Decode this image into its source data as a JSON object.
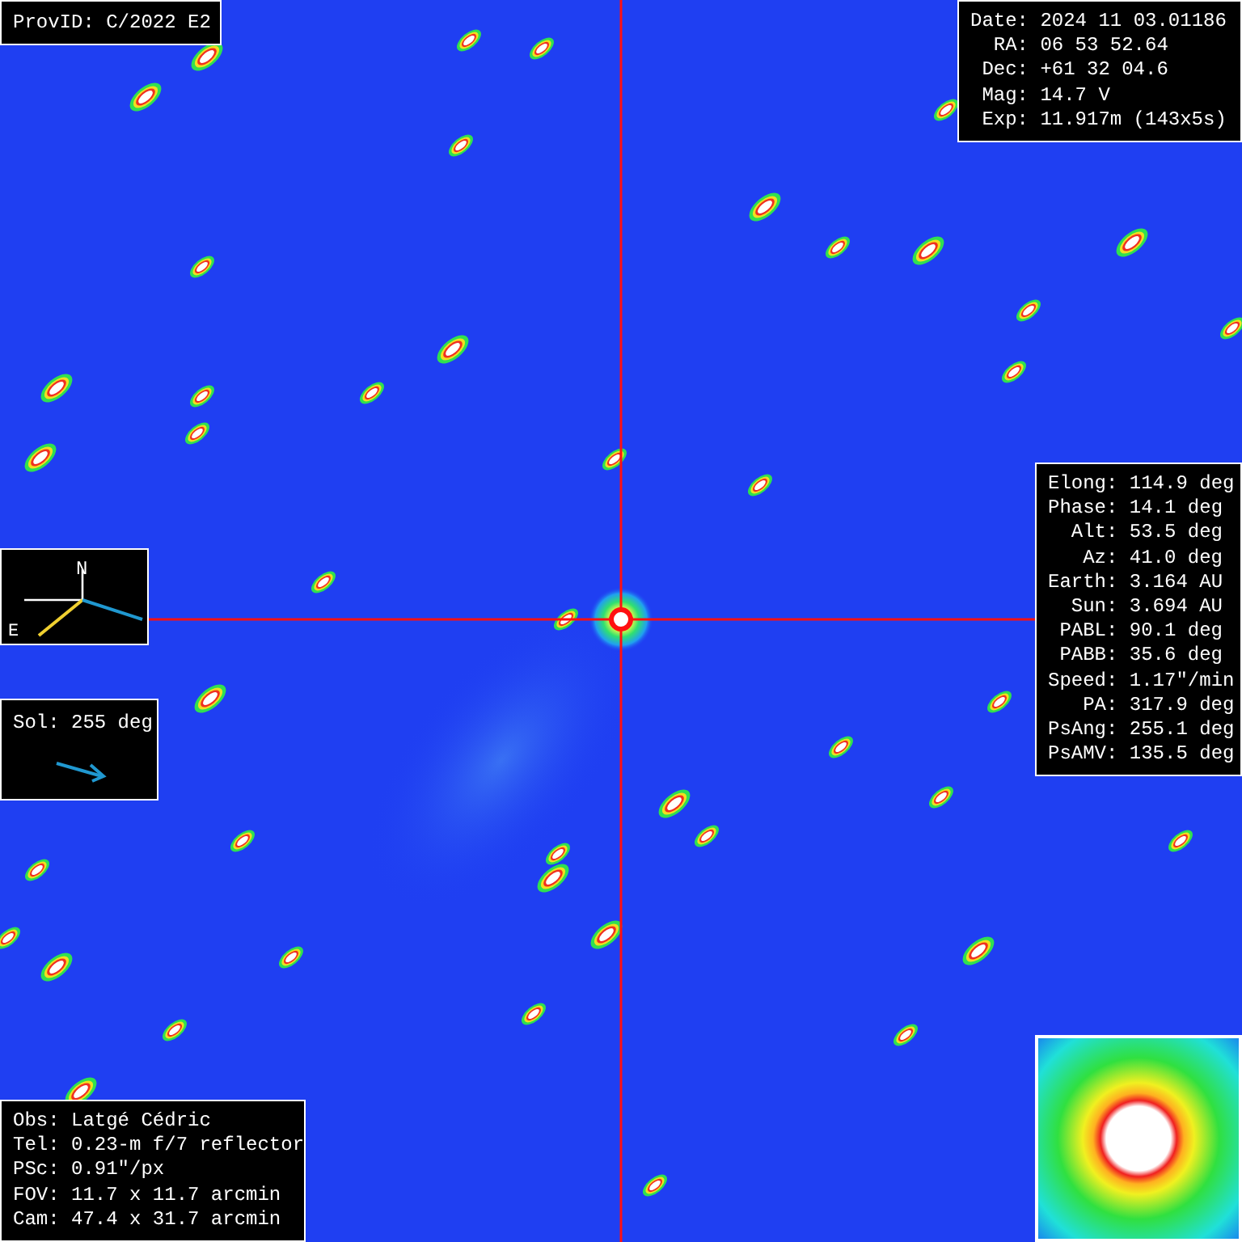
{
  "header": {
    "prov_id": "ProvID: C/2022 E2"
  },
  "observation": {
    "lines": [
      "Date: 2024 11 03.01186",
      "RA: 06 53 52.64",
      "Dec: +61 32 04.6",
      "Mag: 14.7 V",
      "Exp: 11.917m (143x5s)"
    ]
  },
  "geometry": {
    "lines": [
      "Elong: 114.9 deg",
      "Phase: 14.1 deg",
      "Alt: 53.5 deg",
      "Az: 41.0 deg",
      "Earth: 3.164 AU",
      "Sun: 3.694 AU",
      "PABL: 90.1 deg",
      "PABB: 35.6 deg",
      "Speed: 1.17\"/min",
      "PA: 317.9 deg",
      "PsAng: 255.1 deg",
      "PsAMV: 135.5 deg"
    ]
  },
  "compass": {
    "north": "N",
    "east": "E"
  },
  "sun_direction": {
    "label": "Sol: 255 deg"
  },
  "observer": {
    "lines": [
      "Obs: Latgé Cédric",
      "Tel: 0.23-m f/7 reflector",
      "PSc: 0.91\"/px",
      "FOV: 11.7 x 11.7 arcmin",
      "Cam: 47.4 x 31.7 arcmin"
    ]
  }
}
